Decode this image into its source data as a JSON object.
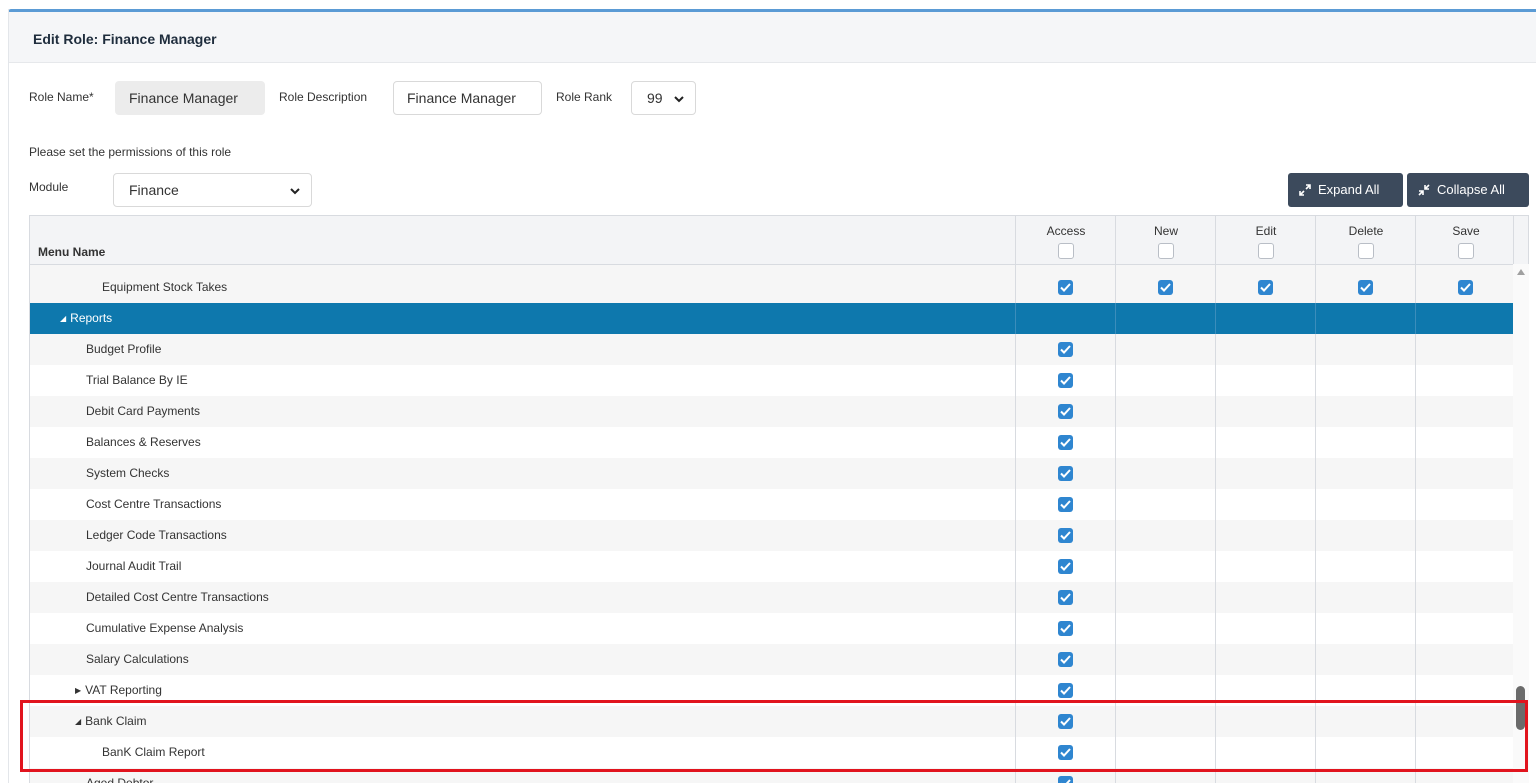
{
  "header": {
    "title": "Edit Role: Finance Manager"
  },
  "form": {
    "role_name_label": "Role Name*",
    "role_name_value": "Finance Manager",
    "role_description_label": "Role Description",
    "role_description_value": "Finance Manager",
    "role_rank_label": "Role Rank",
    "role_rank_value": "99",
    "instructions": "Please set the permissions of this role",
    "module_label": "Module",
    "module_value": "Finance"
  },
  "buttons": {
    "expand_all": "Expand All",
    "collapse_all": "Collapse All"
  },
  "table": {
    "menu_header": "Menu Name",
    "columns": [
      "Access",
      "New",
      "Edit",
      "Delete",
      "Save"
    ],
    "rows": [
      {
        "name": "Equipment Stock Takes",
        "indent": 2,
        "type": "item",
        "checks": [
          true,
          true,
          true,
          true,
          true
        ]
      },
      {
        "name": "Reports",
        "indent": 0,
        "type": "group-expanded",
        "checks": [
          false,
          false,
          false,
          false,
          false
        ]
      },
      {
        "name": "Budget Profile",
        "indent": 1,
        "type": "item",
        "checks": [
          true,
          false,
          false,
          false,
          false
        ]
      },
      {
        "name": "Trial Balance By IE",
        "indent": 1,
        "type": "item",
        "checks": [
          true,
          false,
          false,
          false,
          false
        ]
      },
      {
        "name": "Debit Card Payments",
        "indent": 1,
        "type": "item",
        "checks": [
          true,
          false,
          false,
          false,
          false
        ]
      },
      {
        "name": "Balances & Reserves",
        "indent": 1,
        "type": "item",
        "checks": [
          true,
          false,
          false,
          false,
          false
        ]
      },
      {
        "name": "System Checks",
        "indent": 1,
        "type": "item",
        "checks": [
          true,
          false,
          false,
          false,
          false
        ]
      },
      {
        "name": "Cost Centre Transactions",
        "indent": 1,
        "type": "item",
        "checks": [
          true,
          false,
          false,
          false,
          false
        ]
      },
      {
        "name": "Ledger Code Transactions",
        "indent": 1,
        "type": "item",
        "checks": [
          true,
          false,
          false,
          false,
          false
        ]
      },
      {
        "name": "Journal Audit Trail",
        "indent": 1,
        "type": "item",
        "checks": [
          true,
          false,
          false,
          false,
          false
        ]
      },
      {
        "name": "Detailed Cost Centre Transactions",
        "indent": 1,
        "type": "item",
        "checks": [
          true,
          false,
          false,
          false,
          false
        ]
      },
      {
        "name": "Cumulative Expense Analysis",
        "indent": 1,
        "type": "item",
        "checks": [
          true,
          false,
          false,
          false,
          false
        ]
      },
      {
        "name": "Salary Calculations",
        "indent": 1,
        "type": "item",
        "checks": [
          true,
          false,
          false,
          false,
          false
        ]
      },
      {
        "name": "VAT Reporting",
        "indent": 1,
        "type": "group-collapsed",
        "checks": [
          true,
          false,
          false,
          false,
          false
        ]
      },
      {
        "name": "Bank Claim",
        "indent": 1,
        "type": "group-expanded-sub",
        "checks": [
          true,
          false,
          false,
          false,
          false
        ]
      },
      {
        "name": "BanK Claim Report",
        "indent": 2,
        "type": "item",
        "checks": [
          true,
          false,
          false,
          false,
          false
        ]
      },
      {
        "name": "Aged Debtor",
        "indent": 1,
        "type": "item",
        "checks": [
          true,
          false,
          false,
          false,
          false
        ]
      }
    ]
  },
  "colors": {
    "accent": "#0e78ad",
    "checkbox": "#2f86d0",
    "button": "#3c4a5c",
    "highlight": "#e1141e"
  }
}
